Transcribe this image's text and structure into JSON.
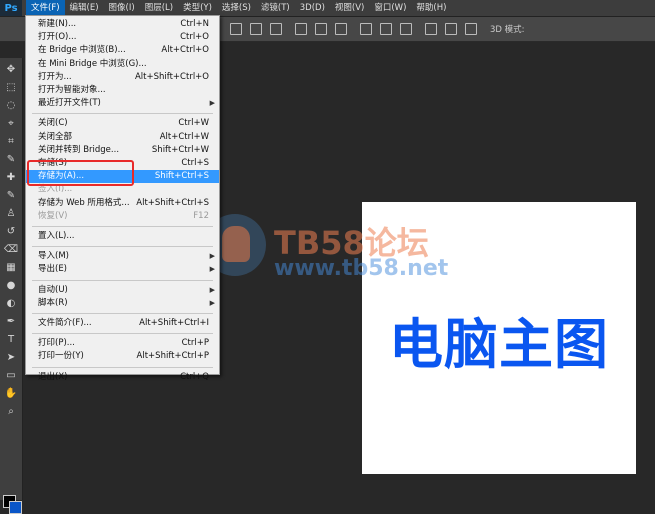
{
  "app": {
    "logo": "Ps"
  },
  "menubar": [
    {
      "label": "文件(F)",
      "active": true
    },
    {
      "label": "编辑(E)"
    },
    {
      "label": "图像(I)"
    },
    {
      "label": "图层(L)"
    },
    {
      "label": "类型(Y)"
    },
    {
      "label": "选择(S)"
    },
    {
      "label": "滤镜(T)"
    },
    {
      "label": "3D(D)"
    },
    {
      "label": "视图(V)"
    },
    {
      "label": "窗口(W)"
    },
    {
      "label": "帮助(H)"
    }
  ],
  "options_bar": {
    "mode_3d_label": "3D 模式:"
  },
  "file_menu": [
    {
      "label": "新建(N)...",
      "shortcut": "Ctrl+N"
    },
    {
      "label": "打开(O)...",
      "shortcut": "Ctrl+O"
    },
    {
      "label": "在 Bridge 中浏览(B)...",
      "shortcut": "Alt+Ctrl+O"
    },
    {
      "label": "在 Mini Bridge 中浏览(G)...",
      "shortcut": ""
    },
    {
      "label": "打开为...",
      "shortcut": "Alt+Shift+Ctrl+O"
    },
    {
      "label": "打开为智能对象...",
      "shortcut": ""
    },
    {
      "label": "最近打开文件(T)",
      "shortcut": "",
      "submenu": true
    },
    {
      "separator": true
    },
    {
      "label": "关闭(C)",
      "shortcut": "Ctrl+W"
    },
    {
      "label": "关闭全部",
      "shortcut": "Alt+Ctrl+W"
    },
    {
      "label": "关闭并转到 Bridge...",
      "shortcut": "Shift+Ctrl+W"
    },
    {
      "label": "存储(S)",
      "shortcut": "Ctrl+S"
    },
    {
      "label": "存储为(A)...",
      "shortcut": "Shift+Ctrl+S",
      "highlighted": true
    },
    {
      "label": "签入(I)...",
      "shortcut": "",
      "disabled": true
    },
    {
      "label": "存储为 Web 所用格式...",
      "shortcut": "Alt+Shift+Ctrl+S"
    },
    {
      "label": "恢复(V)",
      "shortcut": "F12",
      "disabled": true
    },
    {
      "separator": true
    },
    {
      "label": "置入(L)...",
      "shortcut": ""
    },
    {
      "separator": true
    },
    {
      "label": "导入(M)",
      "shortcut": "",
      "submenu": true
    },
    {
      "label": "导出(E)",
      "shortcut": "",
      "submenu": true
    },
    {
      "separator": true
    },
    {
      "label": "自动(U)",
      "shortcut": "",
      "submenu": true
    },
    {
      "label": "脚本(R)",
      "shortcut": "",
      "submenu": true
    },
    {
      "separator": true
    },
    {
      "label": "文件简介(F)...",
      "shortcut": "Alt+Shift+Ctrl+I"
    },
    {
      "separator": true
    },
    {
      "label": "打印(P)...",
      "shortcut": "Ctrl+P"
    },
    {
      "label": "打印一份(Y)",
      "shortcut": "Alt+Shift+Ctrl+P"
    },
    {
      "separator": true
    },
    {
      "label": "退出(X)",
      "shortcut": "Ctrl+Q"
    }
  ],
  "canvas": {
    "text": "电脑主图"
  },
  "watermark": {
    "title": "TB58论坛",
    "url": "www.tb58.net"
  },
  "colors": {
    "accent": "#3399ff",
    "canvas_text": "#0a56f0",
    "highlight_box": "#e82a2a"
  },
  "tools": [
    "move-icon",
    "marquee-icon",
    "lasso-icon",
    "quick-select-icon",
    "crop-icon",
    "eyedropper-icon",
    "healing-brush-icon",
    "brush-icon",
    "clone-stamp-icon",
    "history-brush-icon",
    "eraser-icon",
    "gradient-icon",
    "blur-icon",
    "dodge-icon",
    "pen-icon",
    "type-icon",
    "path-select-icon",
    "shape-icon",
    "hand-icon",
    "zoom-icon"
  ]
}
